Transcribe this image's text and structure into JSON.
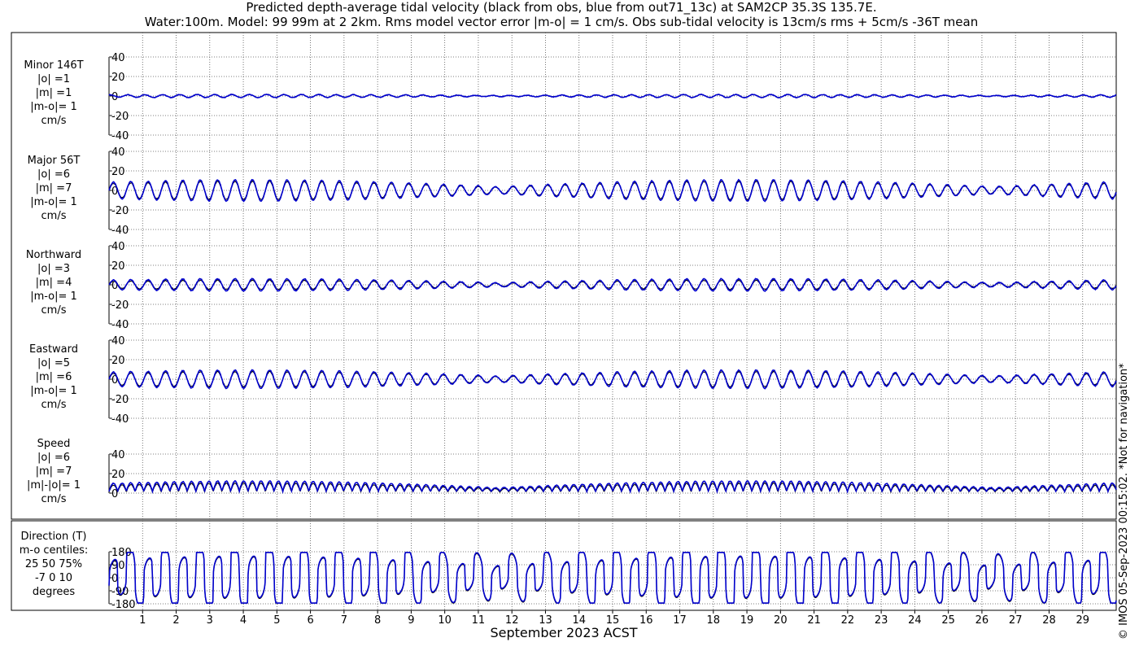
{
  "header": {
    "title_line1": "Predicted depth-average tidal velocity (black from obs, blue from out71_13c) at SAM2CP 35.3S 135.7E.",
    "title_line2": "Water:100m. Model: 99 99m at 2 2km. Rms model vector error |m-o| = 1 cm/s. Obs sub-tidal velocity is 13cm/s rms + 5cm/s -36T mean"
  },
  "footer": {
    "x_axis_label": "September 2023 ACST",
    "copyright": "© IMOS 05-Sep-2023 00:15:02. *Not for navigation*"
  },
  "colors": {
    "observed": "#000000",
    "model": "#0000cc",
    "grid": "#555555"
  },
  "chart_data": [
    {
      "type": "line",
      "panel": "minor",
      "label_lines": [
        "Minor 146T",
        "|o| =1",
        "|m| =1",
        "|m-o|= 1",
        "cm/s"
      ],
      "y_ticks": [
        "40",
        "20",
        "0",
        "-20",
        "-40"
      ],
      "ylim": [
        -40,
        40
      ],
      "xlim": [
        0,
        30
      ],
      "x_ticks": [
        "1",
        "2",
        "3",
        "4",
        "5",
        "6",
        "7",
        "8",
        "9",
        "10",
        "11",
        "12",
        "13",
        "14",
        "15",
        "16",
        "17",
        "18",
        "19",
        "20",
        "21",
        "22",
        "23",
        "24",
        "25",
        "26",
        "27",
        "28",
        "29"
      ],
      "series": [
        {
          "name": "black from obs",
          "amplitude": 1
        },
        {
          "name": "blue from out71_13c",
          "amplitude": 1
        }
      ]
    },
    {
      "type": "line",
      "panel": "major",
      "label_lines": [
        "Major 56T",
        "|o| =6",
        "|m| =7",
        "|m-o|= 1",
        "cm/s"
      ],
      "y_ticks": [
        "40",
        "20",
        "0",
        "-20",
        "-40"
      ],
      "ylim": [
        -40,
        40
      ],
      "xlim": [
        0,
        30
      ],
      "series": [
        {
          "name": "black from obs",
          "amplitude": 6
        },
        {
          "name": "blue from out71_13c",
          "amplitude": 7
        }
      ]
    },
    {
      "type": "line",
      "panel": "northward",
      "label_lines": [
        "Northward",
        "|o| =3",
        "|m| =4",
        "|m-o|= 1",
        "cm/s"
      ],
      "y_ticks": [
        "40",
        "20",
        "0",
        "-20",
        "-40"
      ],
      "ylim": [
        -40,
        40
      ],
      "xlim": [
        0,
        30
      ],
      "series": [
        {
          "name": "black from obs",
          "amplitude": 3
        },
        {
          "name": "blue from out71_13c",
          "amplitude": 4
        }
      ]
    },
    {
      "type": "line",
      "panel": "eastward",
      "label_lines": [
        "Eastward",
        "|o| =5",
        "|m| =6",
        "|m-o|= 1",
        "cm/s"
      ],
      "y_ticks": [
        "40",
        "20",
        "0",
        "-20",
        "-40"
      ],
      "ylim": [
        -40,
        40
      ],
      "xlim": [
        0,
        30
      ],
      "series": [
        {
          "name": "black from obs",
          "amplitude": 5
        },
        {
          "name": "blue from out71_13c",
          "amplitude": 6
        }
      ]
    },
    {
      "type": "line",
      "panel": "speed",
      "label_lines": [
        "Speed",
        "|o| =6",
        "|m| =7",
        "|m|-|o|= 1",
        "cm/s"
      ],
      "y_ticks": [
        "40",
        "20",
        "0"
      ],
      "ylim": [
        0,
        40
      ],
      "xlim": [
        0,
        30
      ],
      "series": [
        {
          "name": "black from obs",
          "amplitude": 6
        },
        {
          "name": "blue from out71_13c",
          "amplitude": 7
        }
      ]
    },
    {
      "type": "line",
      "panel": "direction",
      "label_lines": [
        "Direction (T)",
        "m-o centiles:",
        "25  50  75%",
        "-7  0 10",
        "degrees"
      ],
      "y_ticks": [
        "180",
        "90",
        "0",
        "-90",
        "-180"
      ],
      "ylim": [
        -180,
        180
      ],
      "xlim": [
        0,
        30
      ],
      "series": [
        {
          "name": "black from obs"
        },
        {
          "name": "blue from out71_13c"
        }
      ]
    }
  ]
}
